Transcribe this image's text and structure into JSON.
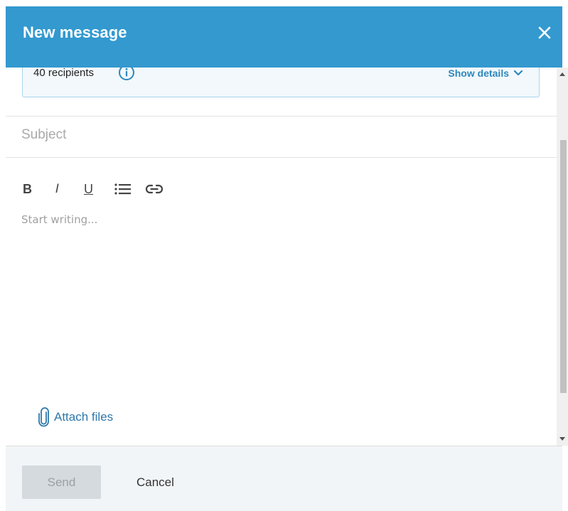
{
  "header": {
    "title": "New message",
    "close_icon": "close-icon"
  },
  "recipients": {
    "count_label": "40 recipients",
    "info_icon": "info-icon",
    "show_details_label": "Show details",
    "chevron_icon": "chevron-down-icon"
  },
  "subject": {
    "placeholder": "Subject",
    "value": ""
  },
  "toolbar": {
    "bold_label": "B",
    "italic_label": "I",
    "underline_label": "U",
    "list_icon": "bulleted-list-icon",
    "link_icon": "link-icon"
  },
  "editor": {
    "placeholder": "Start writing..."
  },
  "attachments": {
    "label": "Attach files",
    "icon": "paperclip-icon"
  },
  "footer": {
    "send_label": "Send",
    "cancel_label": "Cancel"
  },
  "colors": {
    "header_bg": "#3399cf",
    "link": "#2d87bd",
    "footer_bg": "#f2f5f8",
    "send_disabled_bg": "#d4dade"
  }
}
